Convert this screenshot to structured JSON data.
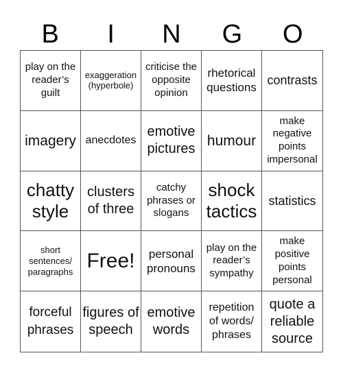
{
  "header": {
    "letters": [
      "B",
      "I",
      "N",
      "G",
      "O"
    ]
  },
  "cells": [
    [
      "play on the reader’s guilt",
      "exaggeration (hyperbole)",
      "criticise the opposite opinion",
      "rhetorical questions",
      "contrasts"
    ],
    [
      "imagery",
      "anecdotes",
      "emotive pictures",
      "humour",
      "make negative points impersonal"
    ],
    [
      "chatty style",
      "clusters of three",
      "catchy phrases or slogans",
      "shock tactics",
      "statistics"
    ],
    [
      "short sentences/ paragraphs",
      "Free!",
      "personal pronouns",
      "play on the reader’s sympathy",
      "make positive points personal"
    ],
    [
      "forceful phrases",
      "figures of speech",
      "emotive words",
      "repetition of words/ phrases",
      "quote a reliable source"
    ]
  ]
}
